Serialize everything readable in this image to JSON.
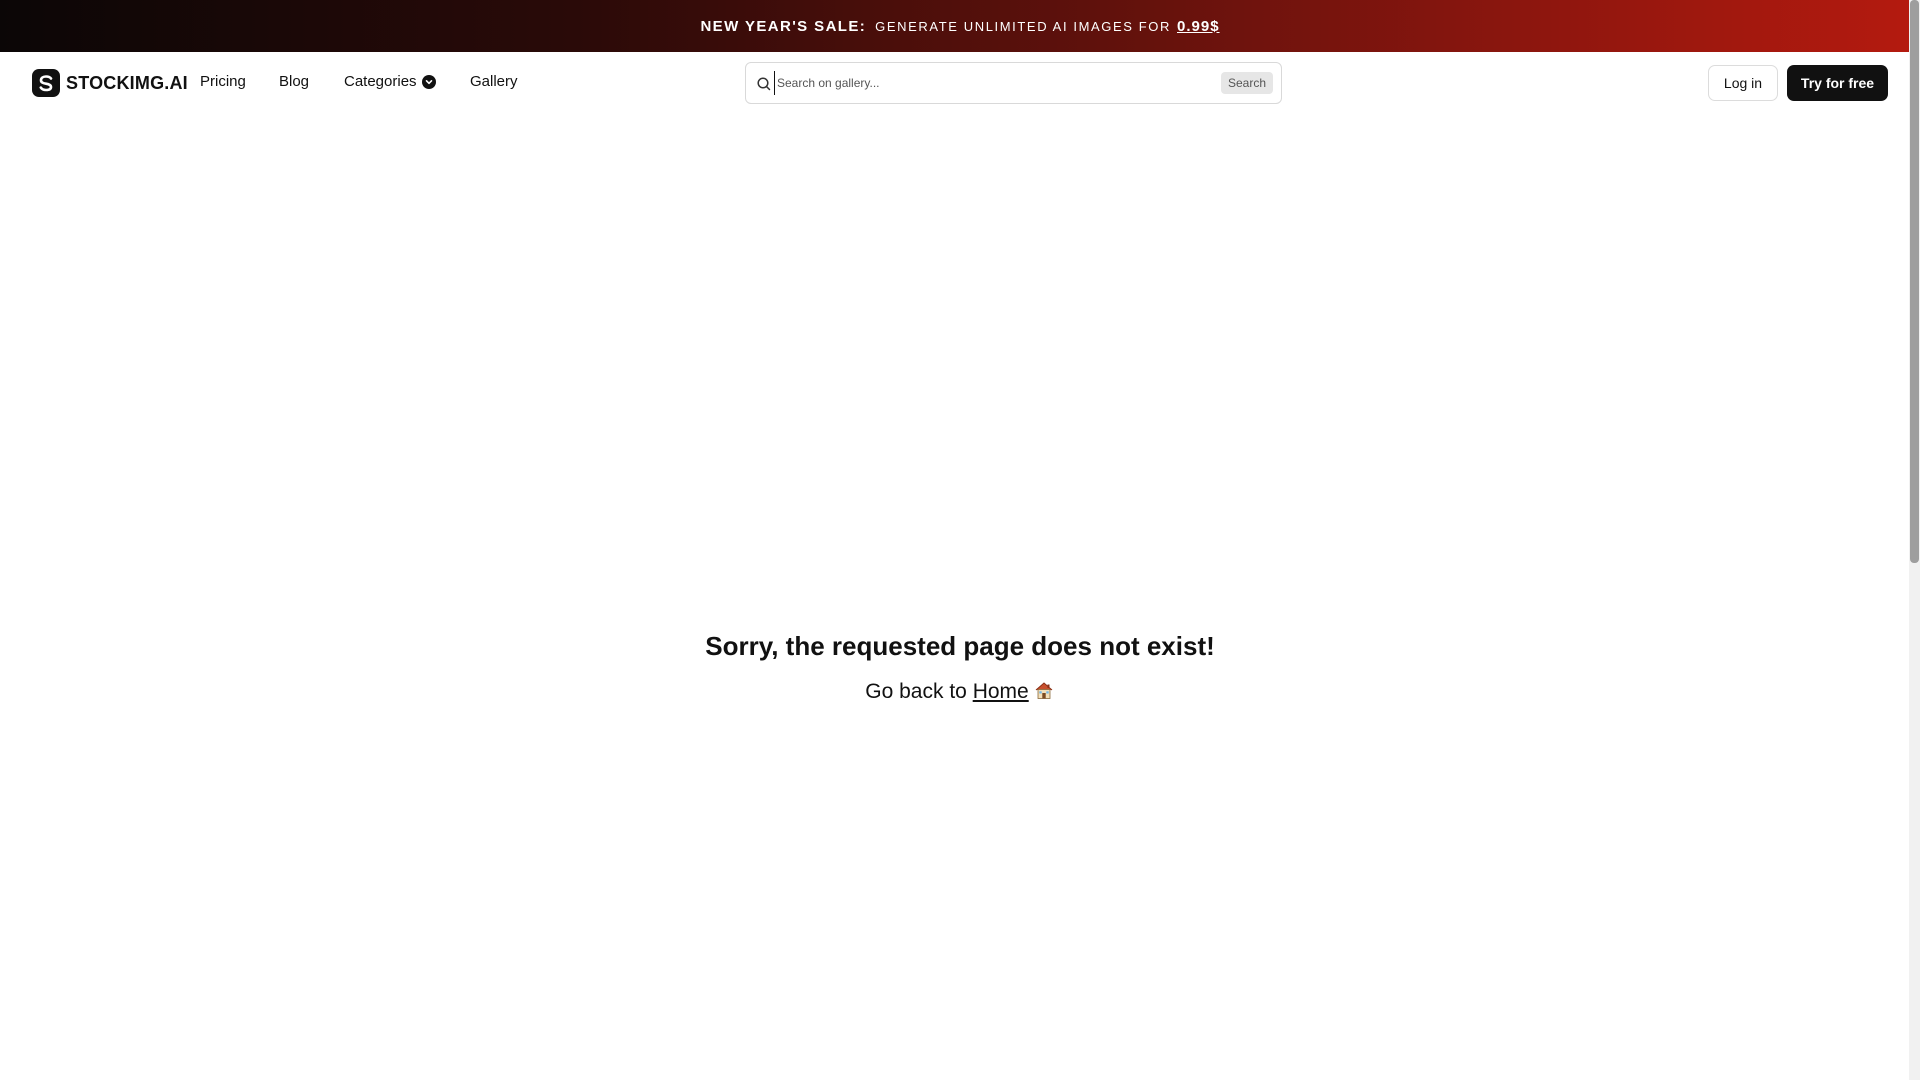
{
  "promo": {
    "strong": "NEW YEAR'S SALE:",
    "text": "GENERATE UNLIMITED AI IMAGES FOR",
    "price": "0.99$"
  },
  "header": {
    "logo_text": "STOCKIMG.AI",
    "nav": {
      "pricing": "Pricing",
      "blog": "Blog",
      "categories": "Categories",
      "gallery": "Gallery"
    },
    "search": {
      "placeholder": "Search on gallery...",
      "button_label": "Search",
      "icon": "search-icon"
    },
    "login_label": "Log in",
    "try_label": "Try for free"
  },
  "main": {
    "title": "Sorry, the requested page does not exist!",
    "go_back_text": "Go back to",
    "home_link": "Home",
    "home_icon": "house-icon"
  },
  "colors": {
    "accent": "#111111",
    "banner_start": "#0b0606",
    "banner_end": "#b51a0f"
  }
}
